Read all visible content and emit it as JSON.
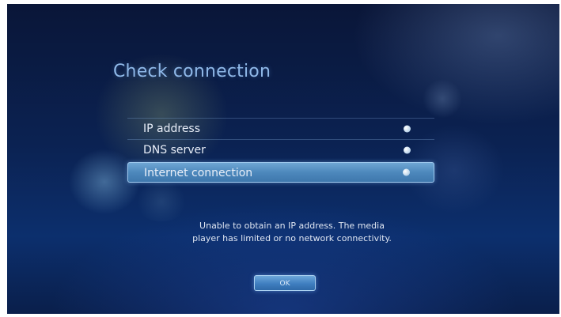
{
  "dialog": {
    "title": "Check connection",
    "items": [
      {
        "label": "IP address",
        "status_icon": "check-icon",
        "selected": false
      },
      {
        "label": "DNS server",
        "status_icon": "check-icon",
        "selected": false
      },
      {
        "label": "Internet connection",
        "status_icon": "check-icon",
        "selected": true
      }
    ],
    "message_lines": [
      "Unable to obtain an IP address. The media",
      "player has limited or no network connectivity."
    ],
    "ok_label": "OK"
  },
  "colors": {
    "title": "#8fb8e8",
    "highlight": "#4d88bc",
    "background": "#0b2252"
  }
}
